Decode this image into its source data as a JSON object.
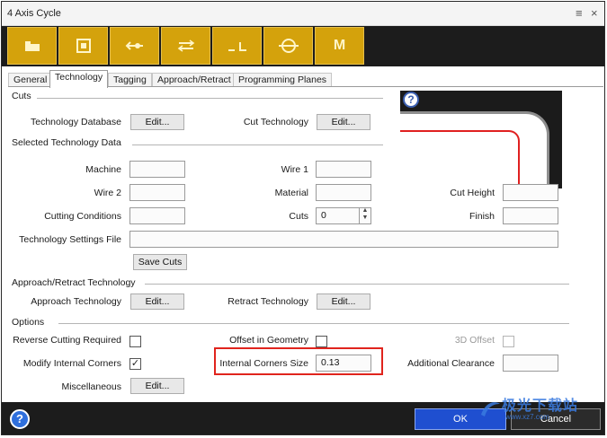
{
  "window": {
    "title": "4 Axis Cycle",
    "menu_icon": "menu-icon",
    "close_icon": "close-icon"
  },
  "toolbar": {
    "buttons": [
      {
        "icon": "folder-icon",
        "glyph": "▙"
      },
      {
        "icon": "square-frame-icon",
        "glyph": "▣"
      },
      {
        "icon": "arrow-left-dot-icon",
        "glyph": "•◀•"
      },
      {
        "icon": "arrow-both-icon",
        "glyph": "⇆"
      },
      {
        "icon": "corner-line-icon",
        "glyph": "_ L"
      },
      {
        "icon": "circle-line-icon",
        "glyph": "⊖"
      },
      {
        "icon": "m-icon",
        "glyph": "M"
      }
    ]
  },
  "tabs": [
    "General",
    "Technology",
    "Tagging",
    "Approach/Retract",
    "Programming Planes"
  ],
  "active_tab": "Technology",
  "cuts": {
    "section": "Cuts",
    "technology_database_label": "Technology Database",
    "technology_database_button": "Edit...",
    "cut_technology_label": "Cut Technology",
    "cut_technology_button": "Edit..."
  },
  "selected": {
    "section": "Selected Technology Data",
    "machine_label": "Machine",
    "machine_value": "",
    "wire1_label": "Wire 1",
    "wire1_value": "",
    "wire2_label": "Wire 2",
    "wire2_value": "",
    "material_label": "Material",
    "material_value": "",
    "cut_height_label": "Cut Height",
    "cut_height_value": "",
    "cutting_conditions_label": "Cutting Conditions",
    "cutting_conditions_value": "",
    "cuts_label": "Cuts",
    "cuts_value": "0",
    "finish_label": "Finish",
    "finish_value": "",
    "settings_file_label": "Technology Settings File",
    "settings_file_value": "",
    "save_cuts_button": "Save Cuts"
  },
  "approach": {
    "section": "Approach/Retract Technology",
    "approach_label": "Approach Technology",
    "approach_button": "Edit...",
    "retract_label": "Retract Technology",
    "retract_button": "Edit..."
  },
  "options": {
    "section": "Options",
    "reverse_label": "Reverse Cutting Required",
    "reverse_checked": false,
    "offset_geometry_label": "Offset in Geometry",
    "offset_geometry_checked": false,
    "offset3d_label": "3D Offset",
    "offset3d_checked": false,
    "modify_corners_label": "Modify Internal Corners",
    "modify_corners_checked": true,
    "corners_size_label": "Internal Corners Size",
    "corners_size_value": "0.13",
    "additional_clearance_label": "Additional Clearance",
    "additional_clearance_value": "",
    "misc_label": "Miscellaneous",
    "misc_button": "Edit..."
  },
  "footer": {
    "help": "?",
    "ok": "OK",
    "cancel": "Cancel"
  },
  "watermark": {
    "text": "极光下载站",
    "sub": "www.xz7.com"
  },
  "colors": {
    "toolbar_gold": "#d4a20c",
    "highlight_red": "#e0241d",
    "ok_blue": "#1f4fd0"
  }
}
